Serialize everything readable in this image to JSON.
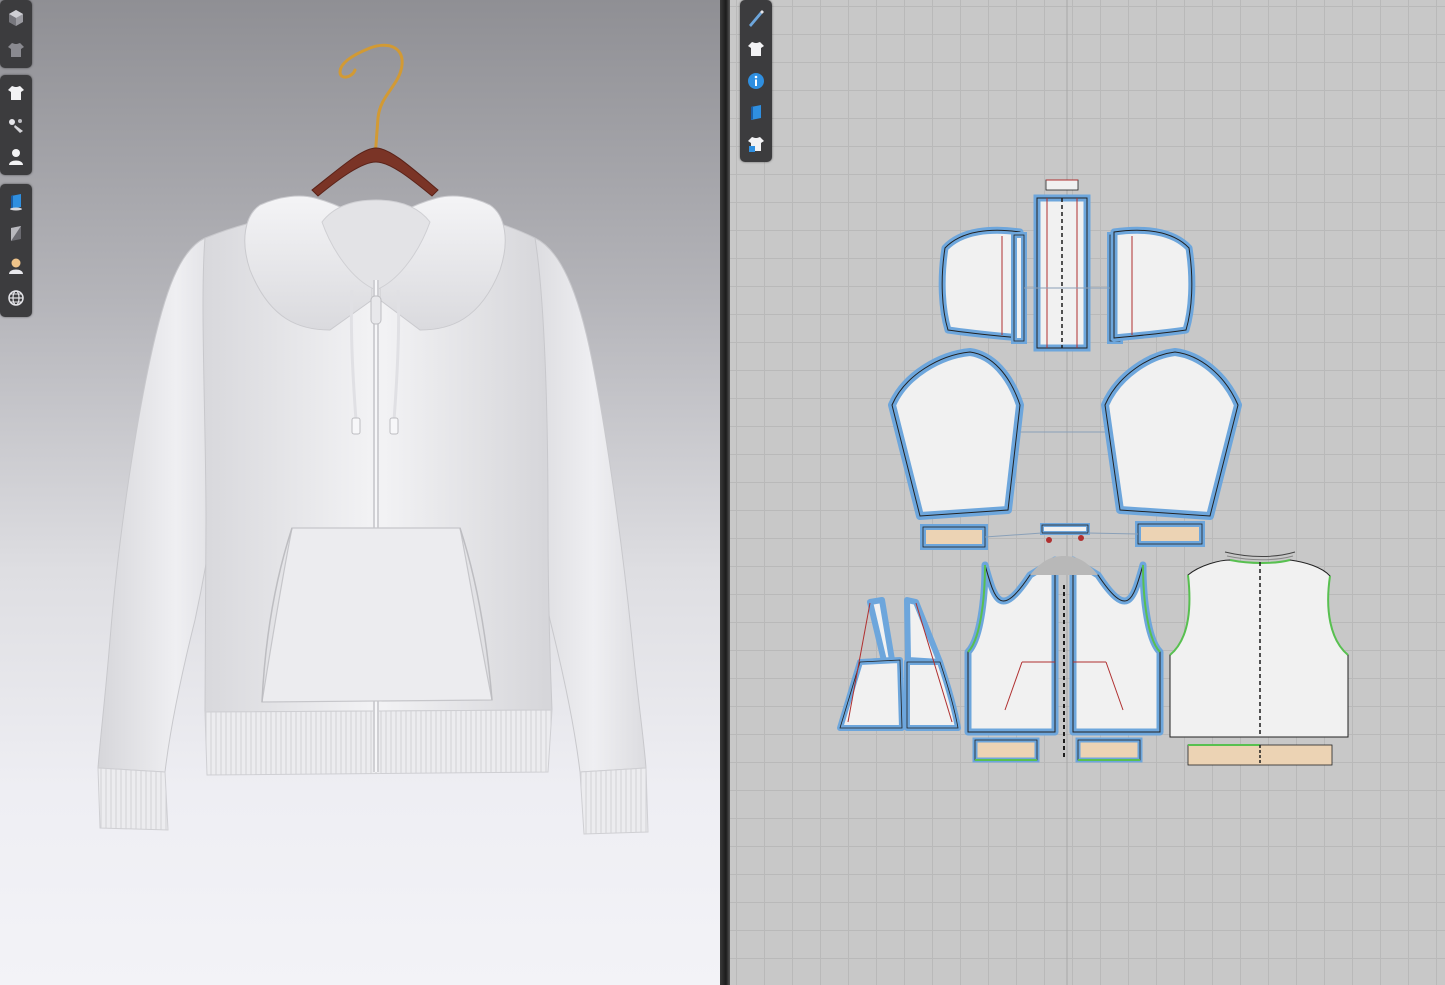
{
  "toolbar_3d_groups": [
    [
      {
        "icon": "cube-display-icon"
      },
      {
        "icon": "garment-display-icon"
      }
    ],
    [
      {
        "icon": "shirt-icon"
      },
      {
        "icon": "fabric-tools-icon"
      },
      {
        "icon": "avatar-icon"
      }
    ],
    [
      {
        "icon": "texture-icon"
      },
      {
        "icon": "shading-icon"
      },
      {
        "icon": "skin-icon"
      },
      {
        "icon": "globe-icon"
      }
    ]
  ],
  "toolbar_2d": [
    {
      "icon": "pen-icon"
    },
    {
      "icon": "shirt-icon"
    },
    {
      "icon": "info-icon"
    },
    {
      "icon": "texture-icon"
    },
    {
      "icon": "pattern-lock-icon"
    }
  ],
  "colors": {
    "seam_outline": "#6da6dc",
    "pattern_fill": "#f1f1f1",
    "rib_fill": "#ecd3b4",
    "hanger_wood": "#7a3426",
    "hanger_wire": "#d29a34",
    "garment": "#ececec",
    "grain_line": "#1c1c1c",
    "green_seam": "#58c050",
    "red_seam": "#b03030"
  }
}
